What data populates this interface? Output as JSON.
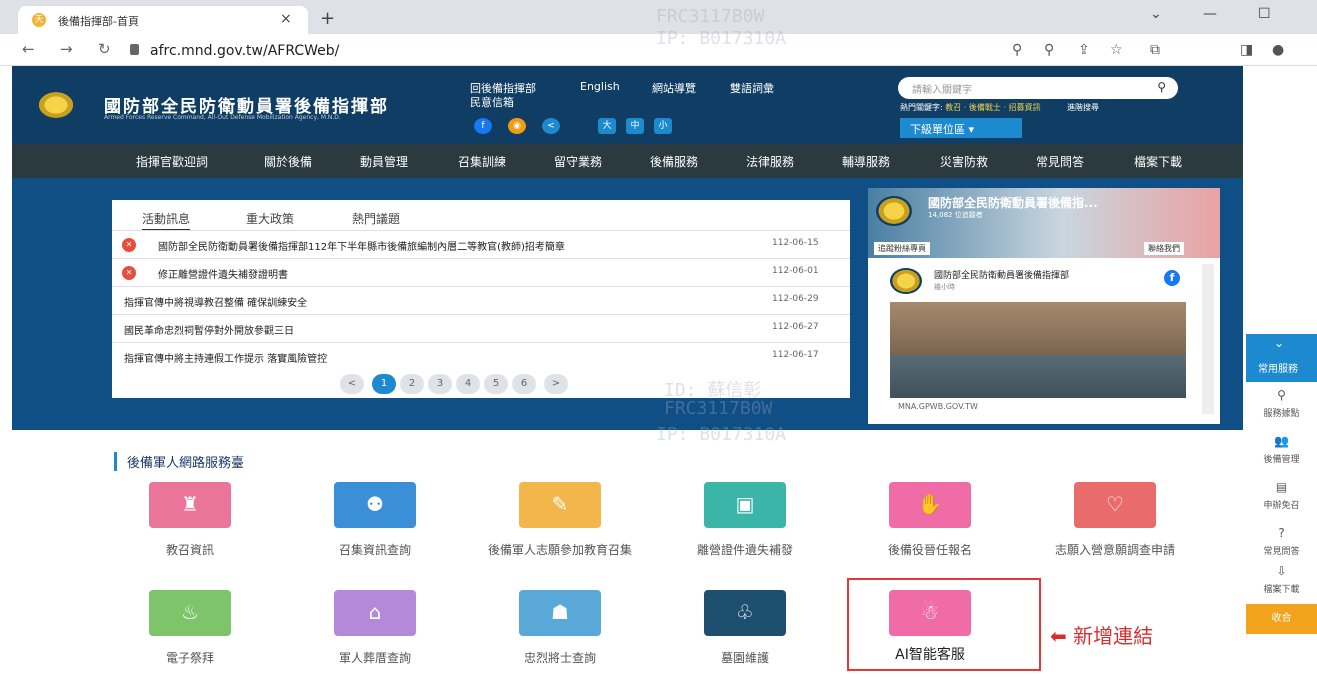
{
  "browser": {
    "tab_title": "後備指揮部-首頁",
    "tab_favicon": "天",
    "close_glyph": "×",
    "new_tab_glyph": "+",
    "url": "afrc.mnd.gov.tw/AFRCWeb/",
    "win_min": "—",
    "win_max": "☐",
    "win_more": "⌄"
  },
  "header": {
    "site_title": "國防部全民防衛動員署後備指揮部",
    "site_subtitle": "Armed Forces Reserve Command, All-Out Defense Mobilization Agency, M.N.D.",
    "links": [
      "回後備指揮部",
      "English",
      "網站導覽",
      "雙語詞彙",
      "民意信箱"
    ],
    "font_size_buttons": [
      "大",
      "中",
      "小"
    ],
    "search_placeholder": "請輸入關鍵字",
    "hot_keywords_label": "熱門關鍵字:",
    "hot_keywords": "教召 · 後備戰士 · 招募資訊",
    "advanced_search": "進階搜尋",
    "unit_dropdown": "下級單位區 ▾"
  },
  "menu": [
    "指揮官歡迎詞",
    "關於後備",
    "動員管理",
    "召集訓練",
    "留守業務",
    "後備服務",
    "法律服務",
    "輔導服務",
    "災害防救",
    "常見問答",
    "檔案下載"
  ],
  "news": {
    "tabs": [
      "活動訊息",
      "重大政策",
      "熱門議題"
    ],
    "items": [
      {
        "title": "國防部全民防衛動員署後備指揮部112年下半年縣市後備旅編制內層二等教官(教師)招考簡章",
        "date": "112-06-15",
        "pinned": true
      },
      {
        "title": "修正離營證件遺失補發證明書",
        "date": "112-06-01",
        "pinned": true
      },
      {
        "title": "指揮官傳中將視導教召整備 確保訓練安全",
        "date": "112-06-29",
        "pinned": false
      },
      {
        "title": "國民革命忠烈祠暫停對外開放參觀三日",
        "date": "112-06-27",
        "pinned": false
      },
      {
        "title": "指揮官傳中將主持連假工作提示 落實風險管控",
        "date": "112-06-17",
        "pinned": false
      }
    ],
    "pager": [
      "<",
      "1",
      "2",
      "3",
      "4",
      "5",
      "6",
      ">"
    ],
    "current_page": "1"
  },
  "facebook": {
    "page_name": "國防部全民防衛動員署後備指...",
    "followers": "14,082 位追蹤者",
    "like_label": "追蹤粉絲專頁",
    "contact_label": "聯絡我們",
    "post_author": "國防部全民防衛動員署後備指揮部",
    "post_time": "幾小時",
    "domain": "MNA.GPWB.GOV.TW"
  },
  "side_panel": {
    "toggle_label": "常用服務",
    "items": [
      {
        "icon": "location-pin-icon",
        "glyph": "⚲",
        "label": "服務據點"
      },
      {
        "icon": "people-icon",
        "glyph": "👥",
        "label": "後備管理"
      },
      {
        "icon": "document-icon",
        "glyph": "▤",
        "label": "申辦免召"
      },
      {
        "icon": "question-icon",
        "glyph": "?",
        "label": "常見問答"
      },
      {
        "icon": "download-icon",
        "glyph": "⇩",
        "label": "檔案下載"
      }
    ],
    "collapse_label": "收合"
  },
  "services": {
    "section_title": "後備軍人網路服務臺",
    "tiles": [
      {
        "label": "教召資訊",
        "color": "#e9769a",
        "icon": "people-building-icon",
        "glyph": "♜"
      },
      {
        "label": "召集資訊查詢",
        "color": "#3b8fd6",
        "icon": "search-people-icon",
        "glyph": "⚉"
      },
      {
        "label": "後備軍人志願參加教育召集",
        "color": "#f2b64a",
        "icon": "pen-icon",
        "glyph": "✎"
      },
      {
        "label": "離營證件遺失補發",
        "color": "#3ab5a8",
        "icon": "id-card-icon",
        "glyph": "▣"
      },
      {
        "label": "後備役晉任報名",
        "color": "#f06ca6",
        "icon": "clapping-hands-icon",
        "glyph": "✋"
      },
      {
        "label": "志願入營意願調查申請",
        "color": "#ea6b6b",
        "icon": "handshake-heart-icon",
        "glyph": "♡"
      },
      {
        "label": "電子祭拜",
        "color": "#7ec46a",
        "icon": "incense-icon",
        "glyph": "♨"
      },
      {
        "label": "軍人葬厝查詢",
        "color": "#b48ad8",
        "icon": "tomb-icon",
        "glyph": "⌂"
      },
      {
        "label": "忠烈將士查詢",
        "color": "#5aa8d8",
        "icon": "soldier-icon",
        "glyph": "☗"
      },
      {
        "label": "墓園維護",
        "color": "#1f4f6e",
        "icon": "tree-icon",
        "glyph": "♧"
      },
      {
        "label": "AI智能客服",
        "color": "#f06ca6",
        "icon": "robot-icon",
        "glyph": "☃"
      }
    ],
    "annotation": "⬅ 新增連結"
  },
  "watermark": {
    "id": "ID: 蘇信彰",
    "code": "FRC3117B0W",
    "ip": "IP: B017310A"
  }
}
